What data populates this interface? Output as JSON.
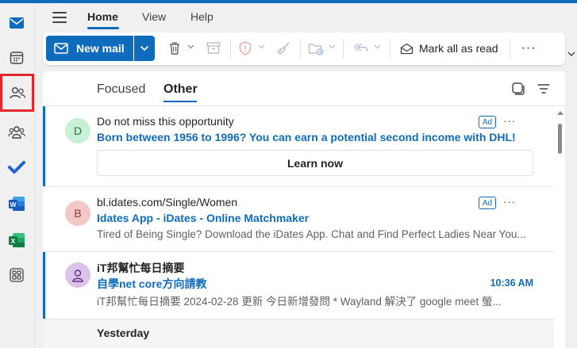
{
  "app": {
    "accent_color": "#0f6cbd",
    "highlight_color": "#e3262b"
  },
  "rail": {
    "items": [
      {
        "icon": "mail-icon",
        "color": "#0f6cbd"
      },
      {
        "icon": "calendar-icon",
        "color": "#424242"
      },
      {
        "icon": "people-icon",
        "color": "#424242",
        "selected": true
      },
      {
        "icon": "groups-icon",
        "color": "#424242"
      },
      {
        "icon": "todo-icon",
        "color": "#2564cf"
      },
      {
        "icon": "word-icon",
        "color": "#185abd"
      },
      {
        "icon": "excel-icon",
        "color": "#107c41"
      },
      {
        "icon": "apps-icon",
        "color": "#424242"
      }
    ]
  },
  "ribbon": {
    "tabs": [
      {
        "label": "Home",
        "active": true
      },
      {
        "label": "View",
        "active": false
      },
      {
        "label": "Help",
        "active": false
      }
    ]
  },
  "toolbar": {
    "new_mail_label": "New mail",
    "mark_all_read_label": "Mark all as read",
    "more_label": "···"
  },
  "list": {
    "pivots": [
      {
        "label": "Focused",
        "active": false
      },
      {
        "label": "Other",
        "active": true
      }
    ],
    "messages": [
      {
        "avatar_initial": "D",
        "avatar_bg": "#c8f0d6",
        "avatar_fg": "#2f6f45",
        "sender": "Do not miss this opportunity",
        "subject": "Born between 1956 to 1996? You can earn a potential second income with DHL!",
        "badge": "Ad",
        "more": "···",
        "action_label": "Learn now"
      },
      {
        "avatar_initial": "B",
        "avatar_bg": "#f4c7c7",
        "avatar_fg": "#8a3a3a",
        "sender": "bl.idates.com/Single/Women",
        "subject": "Idates App - iDates - Online Matchmaker",
        "preview": "Tired of Being Single? Download the iDates App. Chat and Find Perfect Ladies Near You...",
        "badge": "Ad",
        "more": "···"
      },
      {
        "avatar_icon": "person-icon",
        "avatar_bg": "#dcc3ea",
        "avatar_fg": "#5c2e7e",
        "sender": "iT邦幫忙每日摘要",
        "subject": "自學net core方向請教",
        "time": "10:36 AM",
        "preview": "iT邦幫忙每日摘要 2024-02-28 更新 今日新增發問 * Wayland 解決了 google meet 螢..."
      }
    ],
    "group_header": "Yesterday"
  }
}
